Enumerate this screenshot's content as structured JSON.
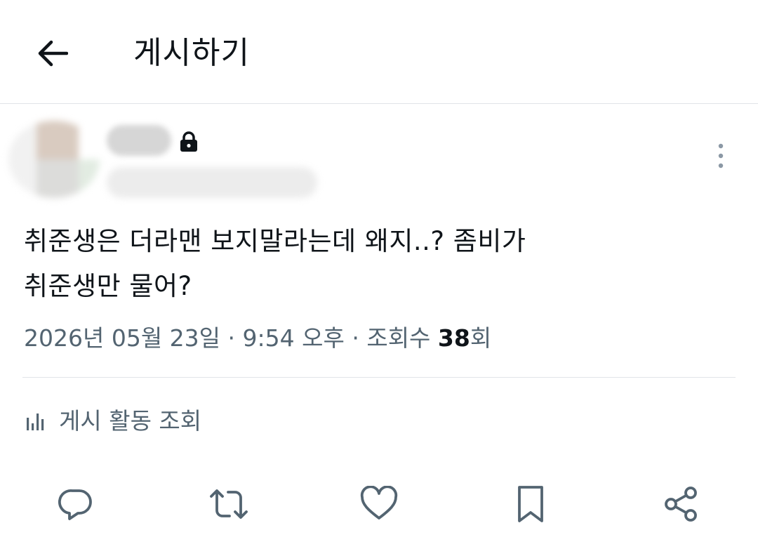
{
  "header": {
    "title": "게시하기",
    "back_icon": "arrow-left-icon"
  },
  "author": {
    "locked_icon": "lock-icon",
    "more_icon": "more-vertical-icon"
  },
  "post": {
    "text": "취준생은 더라맨 보지말라는데 왜지..? 좀비가\n취준생만 물어?"
  },
  "meta": {
    "date": "2026년 05월 23일",
    "sep1": " · ",
    "time": "9:54 오후",
    "sep2": " · ",
    "views_label": "조회수 ",
    "views_count": "38",
    "views_suffix": "회"
  },
  "activity": {
    "label": "게시 활동 조회",
    "icon": "bar-chart-icon"
  },
  "actions": [
    {
      "name": "reply",
      "icon": "reply-icon"
    },
    {
      "name": "repost",
      "icon": "repost-icon"
    },
    {
      "name": "like",
      "icon": "heart-icon"
    },
    {
      "name": "bookmark",
      "icon": "bookmark-icon"
    },
    {
      "name": "share",
      "icon": "share-icon"
    }
  ],
  "colors": {
    "text_primary": "#0f1419",
    "text_secondary": "#536471",
    "divider": "#e1e4e8",
    "icon": "#536471"
  }
}
